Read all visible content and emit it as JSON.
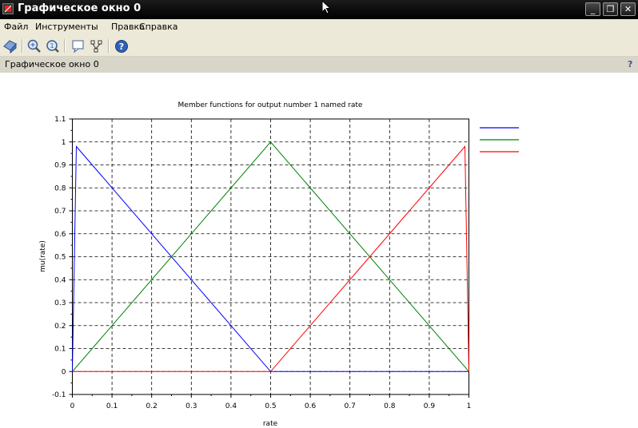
{
  "window": {
    "title": "Графическое окно 0",
    "controls": [
      "_",
      "❐",
      "✕"
    ]
  },
  "menu": [
    "Файл",
    "Инструменты",
    "Правка",
    "Справка"
  ],
  "toolbar": {
    "buttons": [
      "rotate-icon",
      "zoom-in-icon",
      "zoom-out-icon",
      "datatip-icon",
      "edit-axes-icon",
      "help-icon"
    ]
  },
  "status": {
    "text": "Графическое окно 0",
    "help_glyph": "?"
  },
  "colors": {
    "series_blue": "#0000ff",
    "series_green": "#008000",
    "series_red": "#ff0000",
    "grid": "#000000"
  },
  "chart_data": {
    "type": "line",
    "title": "Member functions for output number 1 named rate",
    "xlabel": "rate",
    "ylabel": "mu(rate)",
    "xlim": [
      0,
      1
    ],
    "ylim": [
      -0.1,
      1.1
    ],
    "x_ticks": [
      "0",
      "0.1",
      "0.2",
      "0.3",
      "0.4",
      "0.5",
      "0.6",
      "0.7",
      "0.8",
      "0.9",
      "1"
    ],
    "y_ticks": [
      "-0.1",
      "0",
      "0.1",
      "0.2",
      "0.3",
      "0.4",
      "0.5",
      "0.6",
      "0.7",
      "0.8",
      "0.9",
      "1",
      "1.1"
    ],
    "grid": true,
    "legend_position": "right",
    "series": [
      {
        "color": "#0000ff",
        "x": [
          0,
          0.01,
          0.5,
          1
        ],
        "y": [
          0,
          0.98,
          0,
          0
        ]
      },
      {
        "color": "#008000",
        "x": [
          0,
          0.5,
          1
        ],
        "y": [
          0,
          1,
          0
        ]
      },
      {
        "color": "#ff0000",
        "x": [
          0,
          0.5,
          0.99,
          1
        ],
        "y": [
          0,
          0,
          0.98,
          0
        ]
      }
    ]
  }
}
